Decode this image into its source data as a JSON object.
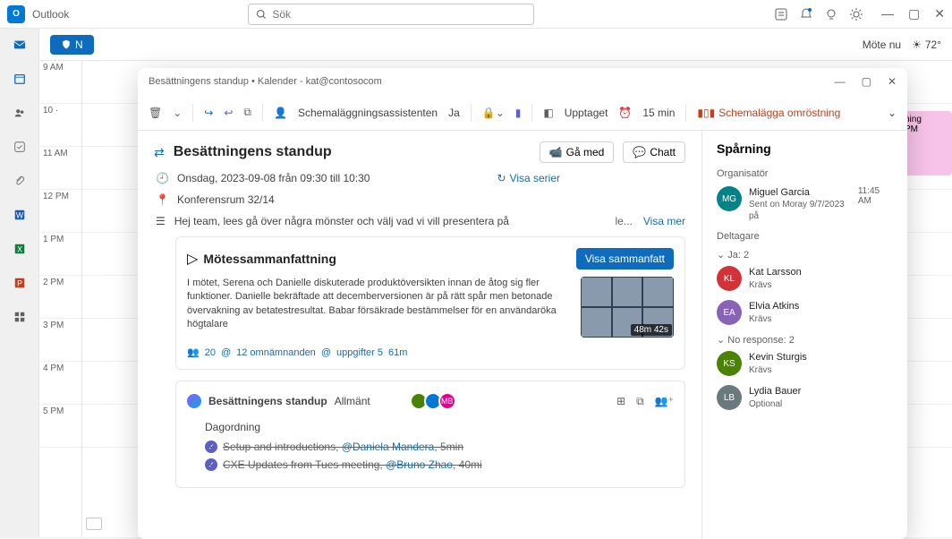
{
  "app": {
    "name": "Outlook",
    "search_placeholder": "Sök"
  },
  "titlebar_icons": [
    "note",
    "bell",
    "bulb",
    "settings"
  ],
  "toolbar": {
    "new_label": "N",
    "meet_now": "Möte nu",
    "temp": "72°"
  },
  "calendar": {
    "hours": [
      "9 AM",
      "10 ·",
      "11 AM",
      "12 PM",
      "1 PM",
      "2 PM",
      "3 PM",
      "4 PM",
      "5 PM"
    ],
    "pink_event": {
      "title": "ning",
      "sub": "PM"
    }
  },
  "modal": {
    "window_title": "Besättningens standup • Kalender - kat@contosocom",
    "toolbar": {
      "scheduling_assistant": "Schemaläggningsassistenten",
      "yes_short": "Ja",
      "busy": "Upptaget",
      "reminder": "15 min",
      "poll": "Schemalägga omröstning"
    },
    "title": "Besättningens standup",
    "join_label": "Gå med",
    "chat_label": "Chatt",
    "when": "Onsdag, 2023-09-08 från 09:30 till 10:30",
    "series_label": "Visa serier",
    "location": "Konferensrum 32/14",
    "description_preview": "Hej team, lees gå över några mönster och välj vad vi vill presentera på",
    "desc_le": "le...",
    "show_more": "Visa mer",
    "recap": {
      "title": "Mötessammanfattning",
      "button": "Visa sammanfatt",
      "text": "I mötet, Serena och Danielle diskuterade produktöversikten innan de åtog sig fler funktioner. Danielle bekräftade att decemberversionen är på rätt spår men betonade övervakning av betatestresultat. Babar försäkrade bestämmelser för en användaröka högtalare",
      "duration": "48m 42s",
      "stats_people": "20",
      "stats_mentions": "12 omnämnanden",
      "stats_tasks": "uppgifter 5",
      "stats_time": "61m"
    },
    "channel": {
      "team": "Besättningens standup",
      "name": "Allmänt",
      "avatars": [
        {
          "bg": "#498205",
          "label": ""
        },
        {
          "bg": "#0078d4",
          "label": ""
        },
        {
          "bg": "#e3008c",
          "label": "MB"
        }
      ],
      "agenda_title": "Dagordning",
      "items": [
        {
          "text": "Setup and introductions,",
          "mention": "@Daniela Mandera",
          "tail": ", 5min"
        },
        {
          "text": "CXE Updates from Tues meeting,",
          "mention": "@Bruno Zhao",
          "tail": ", 40mi"
        }
      ]
    },
    "tracking": {
      "title": "Spårning",
      "organizer_label": "Organisatör",
      "organizer": {
        "name": "Miguel Garcia",
        "sent": "Sent on Moray 9/7/2023 på",
        "time": "11:45 AM",
        "avatar_bg": "#038387"
      },
      "attendees_label": "Deltagare",
      "yes_group": "Ja: 2",
      "yes_people": [
        {
          "name": "Kat Larsson",
          "sub": "Krävs",
          "bg": "#d13438"
        },
        {
          "name": "Elvia Atkins",
          "sub": "Krävs",
          "bg": "#8764b8"
        }
      ],
      "noresp_group": "No response: 2",
      "noresp_people": [
        {
          "name": "Kevin Sturgis",
          "sub": "Krävs",
          "bg": "#498205"
        },
        {
          "name": "Lydia Bauer",
          "sub": "Optional",
          "bg": "#69797e"
        }
      ]
    }
  }
}
